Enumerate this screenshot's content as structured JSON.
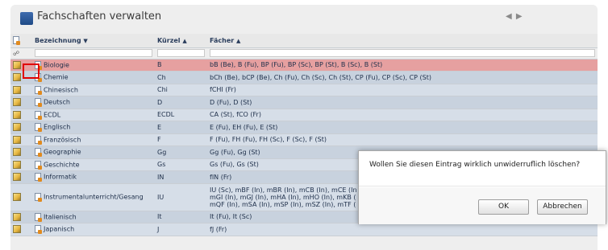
{
  "panel": {
    "title": "Fachschaften verwalten",
    "nav_arrows": "◀ ▶"
  },
  "columns": {
    "bezeichnung": "Bezeichnung",
    "kuerzel": "Kürzel",
    "faecher": "Fächer"
  },
  "rows": [
    {
      "name": "Biologie",
      "kuerzel": "B",
      "faecher": "bB (Be), B (Fu), BP (Fu), BP (Sc), BP (St), B (Sc), B (St)"
    },
    {
      "name": "Chemie",
      "kuerzel": "Ch",
      "faecher": "bCh (Be), bCP (Be), Ch (Fu), Ch (Sc), Ch (St), CP (Fu), CP (Sc), CP (St)"
    },
    {
      "name": "Chinesisch",
      "kuerzel": "Chi",
      "faecher": "fCHI (Fr)"
    },
    {
      "name": "Deutsch",
      "kuerzel": "D",
      "faecher": "D (Fu), D (St)"
    },
    {
      "name": "ECDL",
      "kuerzel": "ECDL",
      "faecher": "CA (St), fCO (Fr)"
    },
    {
      "name": "Englisch",
      "kuerzel": "E",
      "faecher": "E (Fu), EH (Fu), E (St)"
    },
    {
      "name": "Französisch",
      "kuerzel": "F",
      "faecher": "F (Fu), FH (Fu), FH (Sc), F (Sc), F (St)"
    },
    {
      "name": "Geographie",
      "kuerzel": "Gg",
      "faecher": "Gg (Fu), Gg (St)"
    },
    {
      "name": "Geschichte",
      "kuerzel": "Gs",
      "faecher": "Gs (Fu), Gs (St)"
    },
    {
      "name": "Informatik",
      "kuerzel": "IN",
      "faecher": "fIN (Fr)"
    },
    {
      "name": "Instrumentalunterricht/Gesang",
      "kuerzel": "IU",
      "faecher_lines": [
        "IU (Sc), mBF (In), mBR (In), mCB (In), mCE (In",
        "mGI (In), mGJ (In), mHA (In), mHO (In), mKB (",
        "mQF (In), mSA (In), mSP (In), mSZ (In), mTF ("
      ]
    },
    {
      "name": "Italienisch",
      "kuerzel": "It",
      "faecher": "It (Fu), It (Sc)"
    },
    {
      "name": "Japanisch",
      "kuerzel": "J",
      "faecher": "fJ (Fr)"
    }
  ],
  "dialog": {
    "message": "Wollen Sie diesen Eintrag wirklich unwiderruflich löschen?",
    "ok_label": "OK",
    "cancel_label": "Abbrechen"
  },
  "colors": {
    "selected_row": "#e6a0a0",
    "highlight_box": "#e00000",
    "header_text": "#2a3d5c"
  }
}
